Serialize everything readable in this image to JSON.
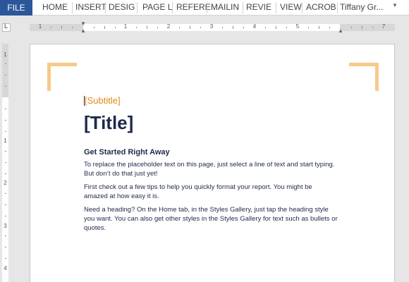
{
  "ribbon": {
    "file_tab": "FILE",
    "tabs": [
      "HOME",
      "INSERT",
      "DESIG",
      "PAGE L",
      "REFERE",
      "MAILIN",
      "REVIE",
      "VIEW",
      "ACROB"
    ],
    "user_name": "Tiffany Gr...",
    "accent_color": "#2b579a"
  },
  "ruler": {
    "tab_selector_symbol": "L",
    "horizontal_numbers": [
      "1",
      "1",
      "2",
      "3",
      "4",
      "5",
      "7"
    ],
    "vertical_numbers": [
      "1",
      "1",
      "2",
      "3",
      "4"
    ]
  },
  "document": {
    "subtitle": "[Subtitle]",
    "title": "[Title]",
    "heading": "Get Started Right Away",
    "paragraphs": [
      "To replace the placeholder text on this page, just select a line of text and start typing. But don’t do that just yet!",
      "First check out a few tips to help you quickly format your report. You might be amazed at how easy it is.",
      "Need a heading? On the Home tab, in the Styles Gallery, just tap the heading style you want. You can also get other styles in the Styles Gallery for text such as bullets or quotes."
    ],
    "accent_color": "#f7c98a"
  }
}
